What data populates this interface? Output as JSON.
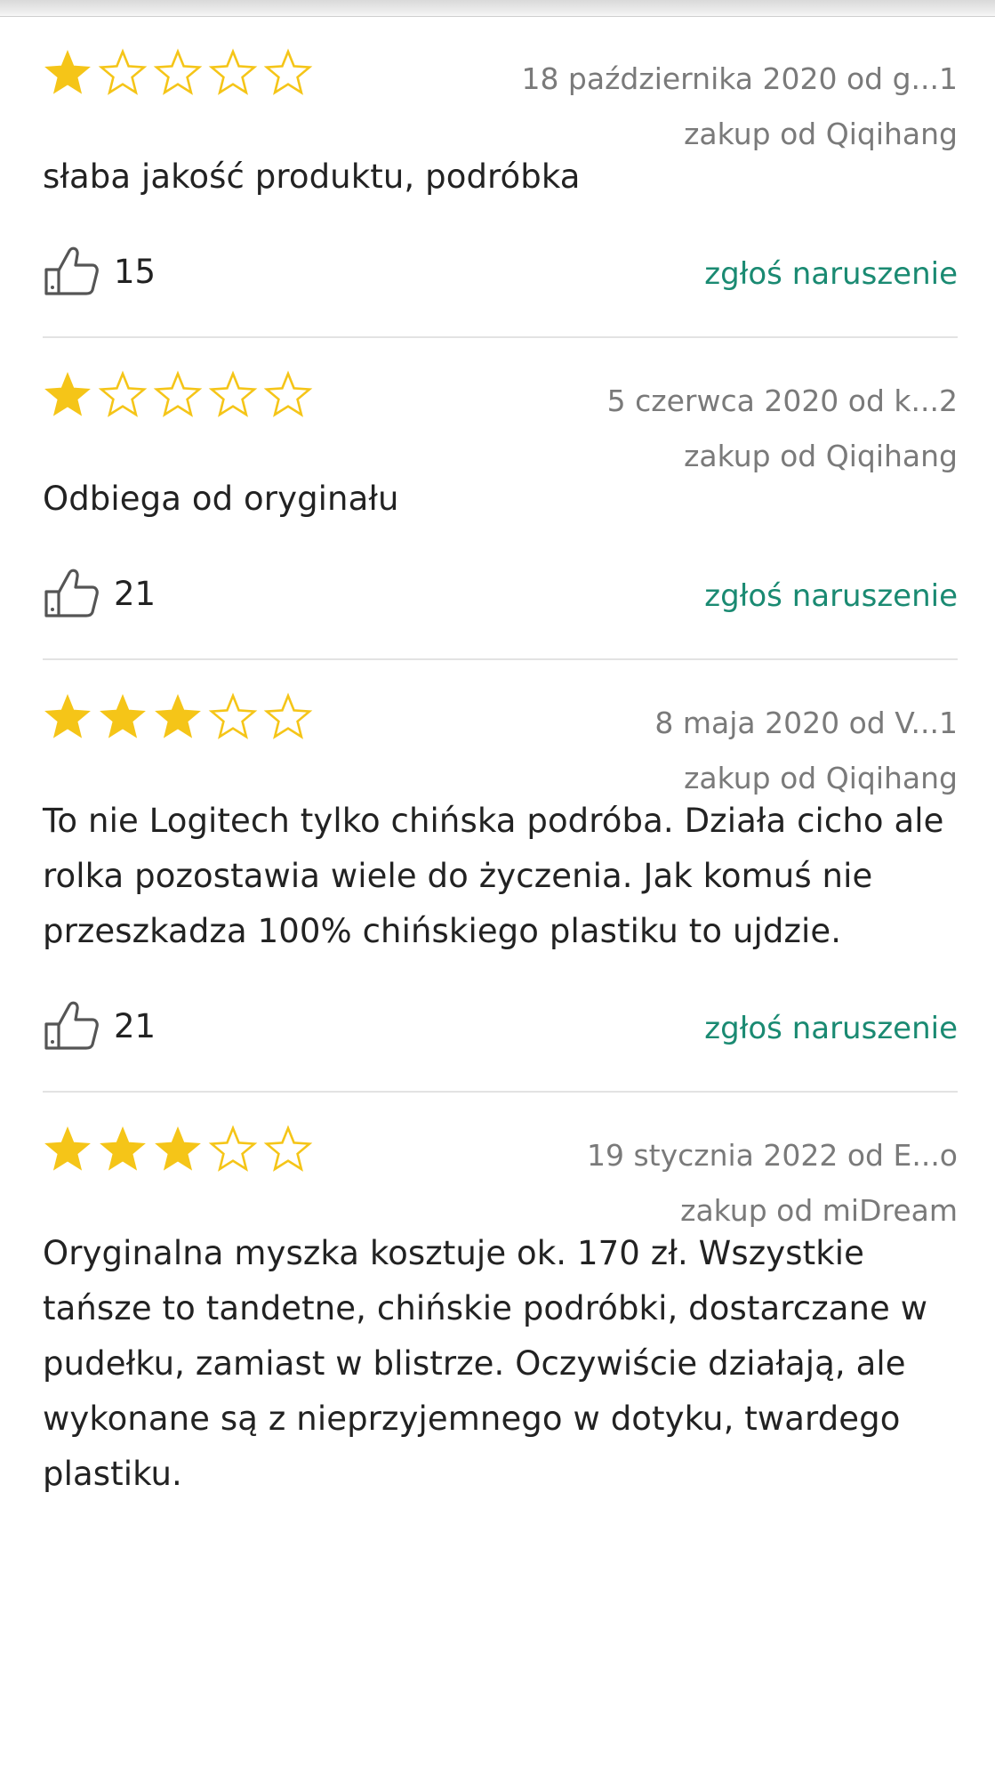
{
  "colors": {
    "star_filled": "#f5c518",
    "star_outline": "#f5c518",
    "link": "#1a8a72",
    "meta": "#7a7a7a",
    "divider": "#e3e3e3"
  },
  "icons": {
    "star": "star-icon",
    "like": "thumbs-up-icon"
  },
  "reviews": [
    {
      "rating": 1,
      "max_rating": 5,
      "date_author": "18 października 2020 od g...1",
      "purchase": "zakup od Qiqihang",
      "text": "słaba jakość produktu, podróbka",
      "likes": "15",
      "report_label": "zgłoś naruszenie"
    },
    {
      "rating": 1,
      "max_rating": 5,
      "date_author": "5 czerwca 2020 od k...2",
      "purchase": "zakup od Qiqihang",
      "text": "Odbiega od oryginału",
      "likes": "21",
      "report_label": "zgłoś naruszenie"
    },
    {
      "rating": 3,
      "max_rating": 5,
      "date_author": "8 maja 2020 od V...1",
      "purchase": "zakup od Qiqihang",
      "text": "To nie Logitech tylko chińska podróba. Działa cicho ale rolka pozostawia wiele do życzenia. Jak komuś nie przeszkadza 100% chińskiego plastiku to ujdzie.",
      "likes": "21",
      "report_label": "zgłoś naruszenie"
    },
    {
      "rating": 3,
      "max_rating": 5,
      "date_author": "19 stycznia 2022 od E...o",
      "purchase": "zakup od miDream",
      "text": "Oryginalna myszka kosztuje ok. 170 zł. Wszystkie tańsze to tandetne, chińskie podróbki, dostarczane w pudełku, zamiast w blistrze. Oczywiście działają, ale wykonane są z nieprzyjemnego w dotyku, twardego plastiku.",
      "likes": "",
      "report_label": ""
    }
  ]
}
